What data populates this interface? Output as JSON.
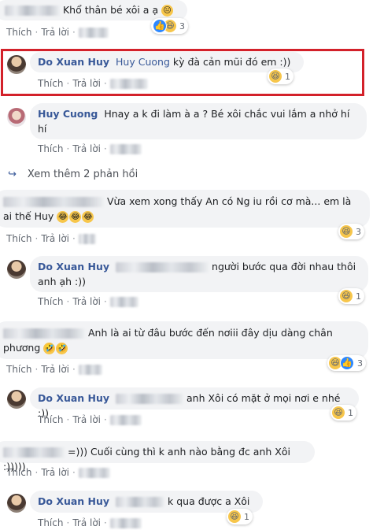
{
  "actions": {
    "like": "Thích",
    "reply": "Trả lời",
    "dot": "·"
  },
  "comments": [
    {
      "text": "Khổ thân bé xôi a ạ",
      "emoji": "😐",
      "reaction_count": "3"
    },
    {
      "name": "Do Xuan Huy",
      "tag": "Huy Cuong",
      "text": "kỳ đà cản mũi đó em :))",
      "reaction_count": "1"
    },
    {
      "name": "Huy Cuong",
      "text": "Hnay a k đi làm à a ? Bé xôi chắc vui lắm a nhở hí hí"
    },
    {
      "text": "Vừa xem xong thấy An có Ng iu rồi cơ mà... em là ai thế Huy",
      "emojis": [
        "😂",
        "😂",
        "😂"
      ],
      "reaction_count": "3"
    },
    {
      "name": "Do Xuan Huy",
      "text": "người bước qua đời nhau thôi anh ạh :))",
      "reaction_count": "1"
    },
    {
      "text": "Anh là ai từ đâu bước đến nơiii đây dịu dàng chân phương",
      "emojis": [
        "🤣",
        "🤣"
      ],
      "reaction_count": "3"
    },
    {
      "name": "Do Xuan Huy",
      "text": "anh Xôi có mặt ở mọi nơi e nhé :))",
      "reaction_count": "1"
    },
    {
      "text": "=))) Cuối cùng thì k anh nào bằng đc anh Xôi :)))))"
    },
    {
      "name": "Do Xuan Huy",
      "text": "k qua được a Xôi",
      "reaction_count": "1"
    }
  ],
  "more_replies": "Xem thêm 2 phản hồi",
  "icons": {
    "like": "thumbs-up-icon",
    "haha": "laughing-face-icon",
    "arrow": "reply-arrow-icon"
  },
  "colors": {
    "name": "#385898",
    "bubble": "#f2f3f5",
    "highlight": "#d3212a",
    "like": "#2d88ff"
  }
}
